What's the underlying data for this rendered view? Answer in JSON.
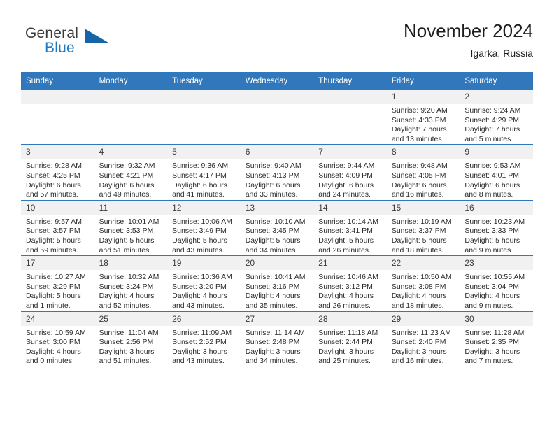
{
  "brand": {
    "name_part1": "General",
    "name_part2": "Blue",
    "accent_color": "#1f7ac4",
    "triangle_color": "#1565a8"
  },
  "header": {
    "title": "November 2024",
    "location": "Igarka, Russia"
  },
  "calendar": {
    "header_bg": "#3177bb",
    "daynum_bg": "#f1f1f1",
    "weekday_headers": [
      "Sunday",
      "Monday",
      "Tuesday",
      "Wednesday",
      "Thursday",
      "Friday",
      "Saturday"
    ],
    "weeks": [
      [
        {
          "day": "",
          "sunrise": "",
          "sunset": "",
          "daylight1": "",
          "daylight2": "",
          "blank": true
        },
        {
          "day": "",
          "sunrise": "",
          "sunset": "",
          "daylight1": "",
          "daylight2": "",
          "blank": true
        },
        {
          "day": "",
          "sunrise": "",
          "sunset": "",
          "daylight1": "",
          "daylight2": "",
          "blank": true
        },
        {
          "day": "",
          "sunrise": "",
          "sunset": "",
          "daylight1": "",
          "daylight2": "",
          "blank": true
        },
        {
          "day": "",
          "sunrise": "",
          "sunset": "",
          "daylight1": "",
          "daylight2": "",
          "blank": true
        },
        {
          "day": "1",
          "sunrise": "Sunrise: 9:20 AM",
          "sunset": "Sunset: 4:33 PM",
          "daylight1": "Daylight: 7 hours",
          "daylight2": "and 13 minutes.",
          "blank": false
        },
        {
          "day": "2",
          "sunrise": "Sunrise: 9:24 AM",
          "sunset": "Sunset: 4:29 PM",
          "daylight1": "Daylight: 7 hours",
          "daylight2": "and 5 minutes.",
          "blank": false
        }
      ],
      [
        {
          "day": "3",
          "sunrise": "Sunrise: 9:28 AM",
          "sunset": "Sunset: 4:25 PM",
          "daylight1": "Daylight: 6 hours",
          "daylight2": "and 57 minutes.",
          "blank": false
        },
        {
          "day": "4",
          "sunrise": "Sunrise: 9:32 AM",
          "sunset": "Sunset: 4:21 PM",
          "daylight1": "Daylight: 6 hours",
          "daylight2": "and 49 minutes.",
          "blank": false
        },
        {
          "day": "5",
          "sunrise": "Sunrise: 9:36 AM",
          "sunset": "Sunset: 4:17 PM",
          "daylight1": "Daylight: 6 hours",
          "daylight2": "and 41 minutes.",
          "blank": false
        },
        {
          "day": "6",
          "sunrise": "Sunrise: 9:40 AM",
          "sunset": "Sunset: 4:13 PM",
          "daylight1": "Daylight: 6 hours",
          "daylight2": "and 33 minutes.",
          "blank": false
        },
        {
          "day": "7",
          "sunrise": "Sunrise: 9:44 AM",
          "sunset": "Sunset: 4:09 PM",
          "daylight1": "Daylight: 6 hours",
          "daylight2": "and 24 minutes.",
          "blank": false
        },
        {
          "day": "8",
          "sunrise": "Sunrise: 9:48 AM",
          "sunset": "Sunset: 4:05 PM",
          "daylight1": "Daylight: 6 hours",
          "daylight2": "and 16 minutes.",
          "blank": false
        },
        {
          "day": "9",
          "sunrise": "Sunrise: 9:53 AM",
          "sunset": "Sunset: 4:01 PM",
          "daylight1": "Daylight: 6 hours",
          "daylight2": "and 8 minutes.",
          "blank": false
        }
      ],
      [
        {
          "day": "10",
          "sunrise": "Sunrise: 9:57 AM",
          "sunset": "Sunset: 3:57 PM",
          "daylight1": "Daylight: 5 hours",
          "daylight2": "and 59 minutes.",
          "blank": false
        },
        {
          "day": "11",
          "sunrise": "Sunrise: 10:01 AM",
          "sunset": "Sunset: 3:53 PM",
          "daylight1": "Daylight: 5 hours",
          "daylight2": "and 51 minutes.",
          "blank": false
        },
        {
          "day": "12",
          "sunrise": "Sunrise: 10:06 AM",
          "sunset": "Sunset: 3:49 PM",
          "daylight1": "Daylight: 5 hours",
          "daylight2": "and 43 minutes.",
          "blank": false
        },
        {
          "day": "13",
          "sunrise": "Sunrise: 10:10 AM",
          "sunset": "Sunset: 3:45 PM",
          "daylight1": "Daylight: 5 hours",
          "daylight2": "and 34 minutes.",
          "blank": false
        },
        {
          "day": "14",
          "sunrise": "Sunrise: 10:14 AM",
          "sunset": "Sunset: 3:41 PM",
          "daylight1": "Daylight: 5 hours",
          "daylight2": "and 26 minutes.",
          "blank": false
        },
        {
          "day": "15",
          "sunrise": "Sunrise: 10:19 AM",
          "sunset": "Sunset: 3:37 PM",
          "daylight1": "Daylight: 5 hours",
          "daylight2": "and 18 minutes.",
          "blank": false
        },
        {
          "day": "16",
          "sunrise": "Sunrise: 10:23 AM",
          "sunset": "Sunset: 3:33 PM",
          "daylight1": "Daylight: 5 hours",
          "daylight2": "and 9 minutes.",
          "blank": false
        }
      ],
      [
        {
          "day": "17",
          "sunrise": "Sunrise: 10:27 AM",
          "sunset": "Sunset: 3:29 PM",
          "daylight1": "Daylight: 5 hours",
          "daylight2": "and 1 minute.",
          "blank": false
        },
        {
          "day": "18",
          "sunrise": "Sunrise: 10:32 AM",
          "sunset": "Sunset: 3:24 PM",
          "daylight1": "Daylight: 4 hours",
          "daylight2": "and 52 minutes.",
          "blank": false
        },
        {
          "day": "19",
          "sunrise": "Sunrise: 10:36 AM",
          "sunset": "Sunset: 3:20 PM",
          "daylight1": "Daylight: 4 hours",
          "daylight2": "and 43 minutes.",
          "blank": false
        },
        {
          "day": "20",
          "sunrise": "Sunrise: 10:41 AM",
          "sunset": "Sunset: 3:16 PM",
          "daylight1": "Daylight: 4 hours",
          "daylight2": "and 35 minutes.",
          "blank": false
        },
        {
          "day": "21",
          "sunrise": "Sunrise: 10:46 AM",
          "sunset": "Sunset: 3:12 PM",
          "daylight1": "Daylight: 4 hours",
          "daylight2": "and 26 minutes.",
          "blank": false
        },
        {
          "day": "22",
          "sunrise": "Sunrise: 10:50 AM",
          "sunset": "Sunset: 3:08 PM",
          "daylight1": "Daylight: 4 hours",
          "daylight2": "and 18 minutes.",
          "blank": false
        },
        {
          "day": "23",
          "sunrise": "Sunrise: 10:55 AM",
          "sunset": "Sunset: 3:04 PM",
          "daylight1": "Daylight: 4 hours",
          "daylight2": "and 9 minutes.",
          "blank": false
        }
      ],
      [
        {
          "day": "24",
          "sunrise": "Sunrise: 10:59 AM",
          "sunset": "Sunset: 3:00 PM",
          "daylight1": "Daylight: 4 hours",
          "daylight2": "and 0 minutes.",
          "blank": false
        },
        {
          "day": "25",
          "sunrise": "Sunrise: 11:04 AM",
          "sunset": "Sunset: 2:56 PM",
          "daylight1": "Daylight: 3 hours",
          "daylight2": "and 51 minutes.",
          "blank": false
        },
        {
          "day": "26",
          "sunrise": "Sunrise: 11:09 AM",
          "sunset": "Sunset: 2:52 PM",
          "daylight1": "Daylight: 3 hours",
          "daylight2": "and 43 minutes.",
          "blank": false
        },
        {
          "day": "27",
          "sunrise": "Sunrise: 11:14 AM",
          "sunset": "Sunset: 2:48 PM",
          "daylight1": "Daylight: 3 hours",
          "daylight2": "and 34 minutes.",
          "blank": false
        },
        {
          "day": "28",
          "sunrise": "Sunrise: 11:18 AM",
          "sunset": "Sunset: 2:44 PM",
          "daylight1": "Daylight: 3 hours",
          "daylight2": "and 25 minutes.",
          "blank": false
        },
        {
          "day": "29",
          "sunrise": "Sunrise: 11:23 AM",
          "sunset": "Sunset: 2:40 PM",
          "daylight1": "Daylight: 3 hours",
          "daylight2": "and 16 minutes.",
          "blank": false
        },
        {
          "day": "30",
          "sunrise": "Sunrise: 11:28 AM",
          "sunset": "Sunset: 2:35 PM",
          "daylight1": "Daylight: 3 hours",
          "daylight2": "and 7 minutes.",
          "blank": false
        }
      ]
    ]
  }
}
